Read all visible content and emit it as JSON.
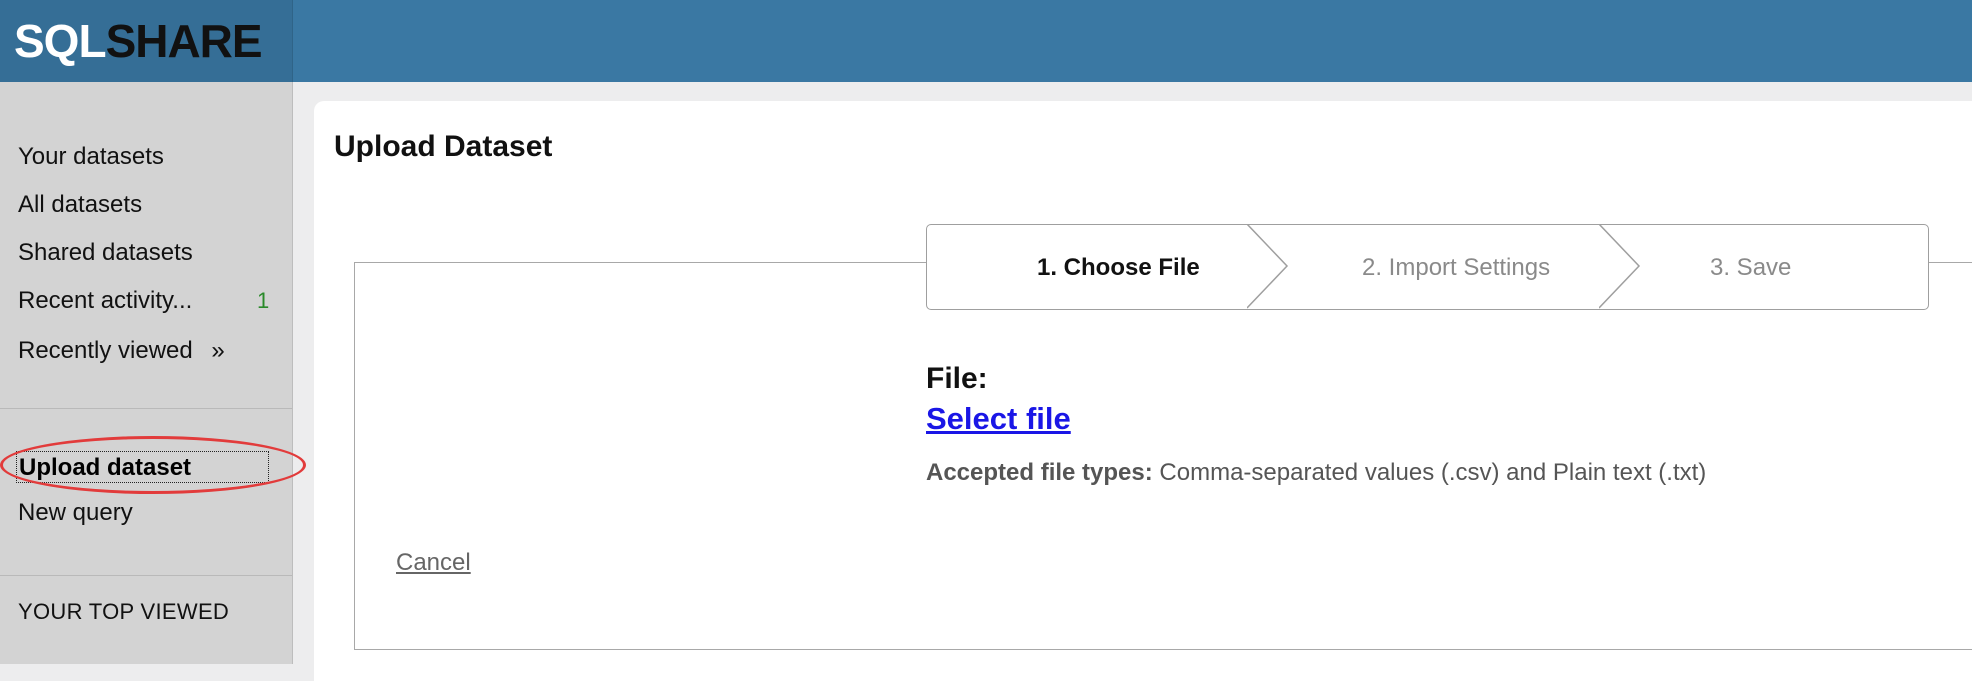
{
  "header": {
    "logo_sql": "SQL",
    "logo_share": "SHARE",
    "bg_color": "#3a78a3"
  },
  "sidebar": {
    "items": [
      {
        "label": "Your datasets"
      },
      {
        "label": "All datasets"
      },
      {
        "label": "Shared datasets"
      },
      {
        "label": "Recent activity...",
        "count": "1"
      },
      {
        "label": "Recently viewed",
        "chevron": "»"
      }
    ],
    "actions": [
      {
        "label": "Upload dataset",
        "active": true
      },
      {
        "label": "New query"
      }
    ],
    "section_title": "YOUR TOP VIEWED"
  },
  "main": {
    "title": "Upload Dataset",
    "steps": [
      {
        "label": "1. Choose File",
        "active": true
      },
      {
        "label": "2. Import Settings",
        "active": false
      },
      {
        "label": "3. Save",
        "active": false
      }
    ],
    "file_label": "File:",
    "select_file": "Select file",
    "accepted_label": "Accepted file types:",
    "accepted_value": " Comma-separated values (.csv) and Plain text (.txt)",
    "cancel": "Cancel"
  },
  "colors": {
    "link": "#1a16e6",
    "highlight": "#e23b3b",
    "count": "#2a8a2a"
  }
}
